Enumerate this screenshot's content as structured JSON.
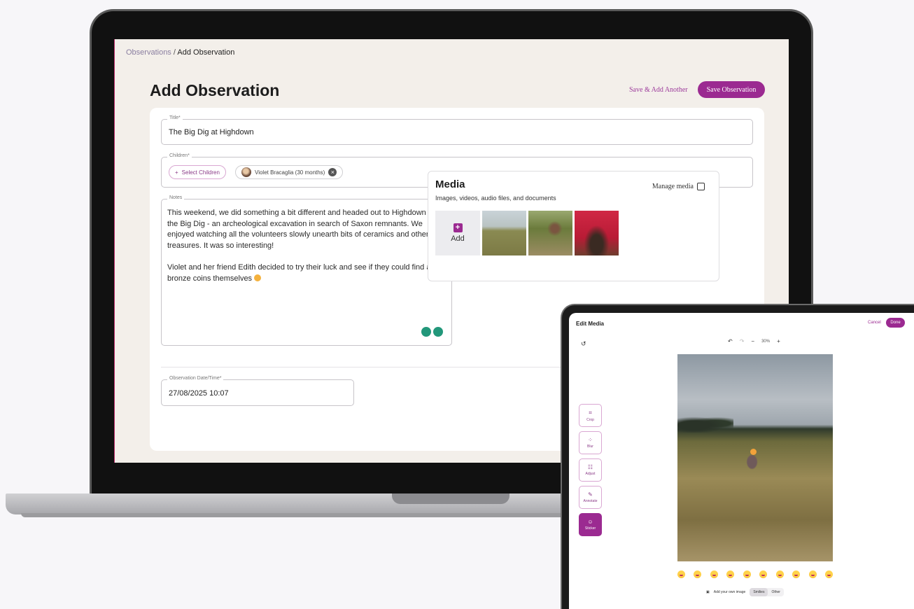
{
  "laptop": {
    "breadcrumb": {
      "parent": "Observations",
      "separator": "/",
      "current": "Add Observation"
    },
    "page_title": "Add Observation",
    "actions": {
      "save_add_another": "Save & Add Another",
      "save": "Save Observation"
    },
    "form": {
      "title_label": "Title*",
      "title_value": "The Big Dig at Highdown",
      "children_label": "Children*",
      "select_children": "Select Children",
      "child_chip": "Violet Bracaglia (30 months)",
      "notes_label": "Notes",
      "notes_paragraph_1": "This weekend, we did something a bit different and headed out to Highdown for the Big Dig - an archeological excavation in search of Saxon remnants. We enjoyed watching all the volunteers slowly unearth bits of ceramics and other treasures. It was so interesting!",
      "notes_paragraph_2": "Violet and her friend Edith decided to try their luck and see if they could find any bronze coins themselves",
      "date_label": "Observation Date/Time*",
      "date_value": "27/08/2025 10:07"
    },
    "media": {
      "title": "Media",
      "subtitle": "Images, videos, audio files, and documents",
      "manage": "Manage media",
      "add": "Add"
    }
  },
  "tablet": {
    "title": "Edit Media",
    "cancel": "Cancel",
    "done": "Done",
    "zoom": "30%",
    "tools": [
      {
        "label": "Crop",
        "glyph": "⌗"
      },
      {
        "label": "Blur",
        "glyph": "⁘"
      },
      {
        "label": "Adjust",
        "glyph": "☷"
      },
      {
        "label": "Annotate",
        "glyph": "✎"
      },
      {
        "label": "Sticker",
        "glyph": "☺"
      }
    ],
    "add_own_image": "Add your own image",
    "seg_smilies": "Smilies",
    "seg_other": "Other"
  },
  "colors": {
    "accent": "#9b2a91",
    "teal": "#22977a"
  }
}
